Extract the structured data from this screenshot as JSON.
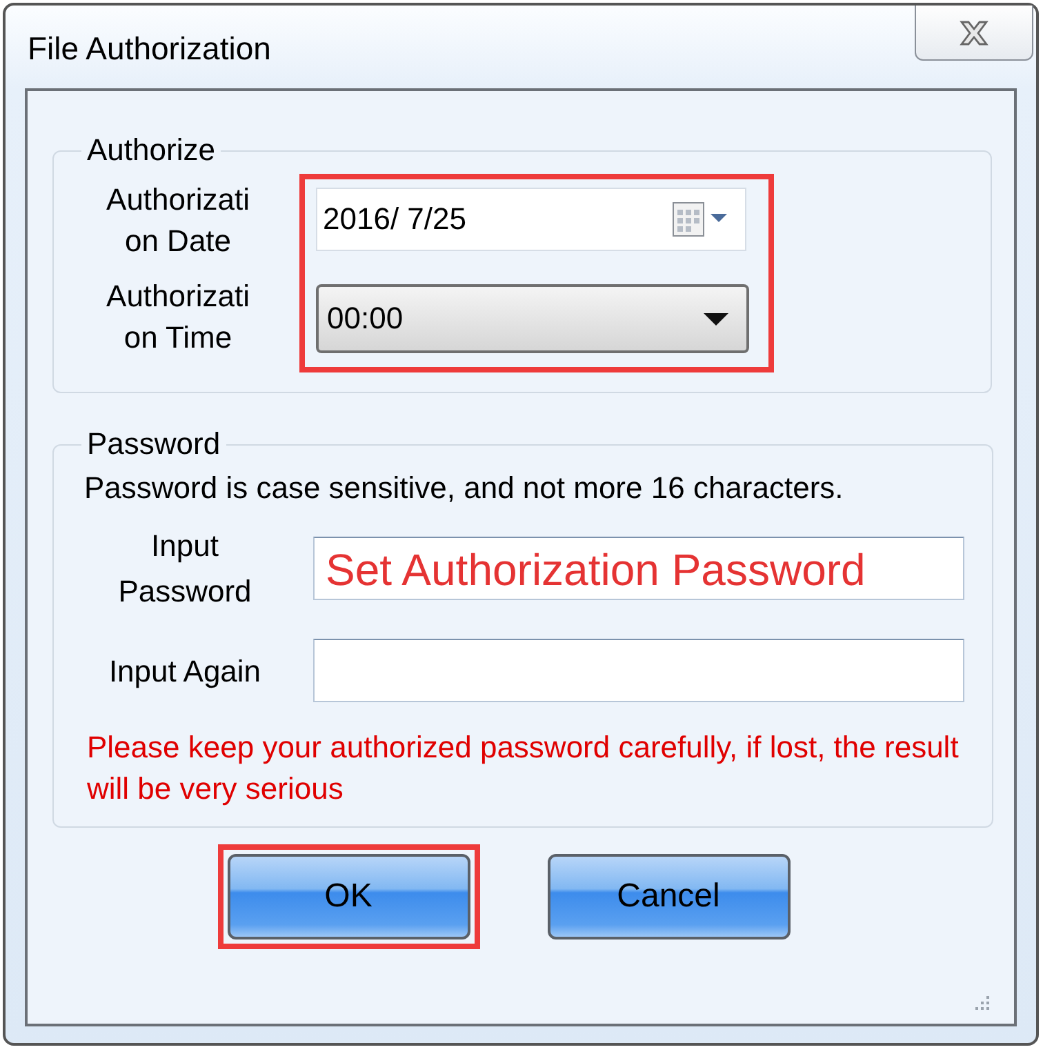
{
  "window": {
    "title": "File Authorization"
  },
  "authorize": {
    "title": "Authorize",
    "highlighted": true,
    "date": {
      "label": "Authorization Date",
      "value": "2016/  7/25"
    },
    "time": {
      "label": "Authorization Time",
      "value": "00:00"
    }
  },
  "password": {
    "title": "Password",
    "note": "Password is case sensitive, and not more 16 characters.",
    "fields": [
      {
        "label": "Input Password",
        "annotation": "Set Authorization Password"
      },
      {
        "label": "Input Again"
      }
    ],
    "warning": "Please keep your authorized password carefully, if lost, the result will be very serious"
  },
  "buttons": [
    {
      "label": "OK",
      "highlighted": true
    },
    {
      "label": "Cancel",
      "highlighted": false
    }
  ]
}
